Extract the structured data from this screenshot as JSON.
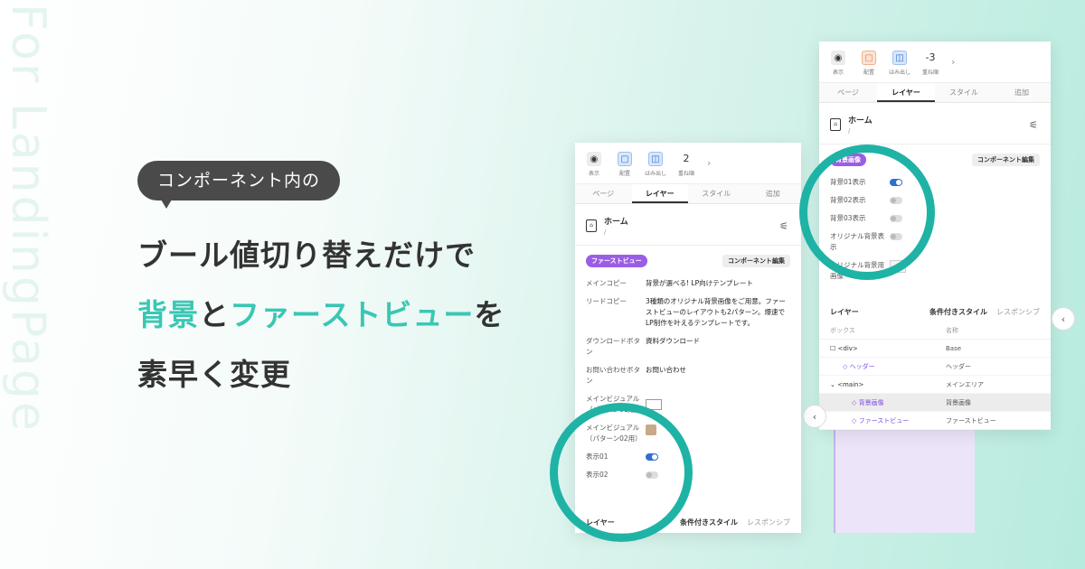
{
  "background_text": "For LandingPage",
  "bubble": "コンポーネント内の",
  "headline": {
    "line1": "ブール値切り替えだけで",
    "line2_a": "背景",
    "line2_b": "と",
    "line2_c": "ファーストビュー",
    "line2_d": "を",
    "line3": "素早く変更"
  },
  "colors": {
    "accent_teal": "#3ac7b4",
    "ring": "#1fb3a6",
    "tag_purple": "#9b5de5",
    "toggle_on": "#2f6fcf"
  },
  "panel_front": {
    "toolbar": [
      {
        "icon": "eye-icon",
        "label": "表示"
      },
      {
        "icon": "align-icon",
        "label": "配置"
      },
      {
        "icon": "overflow-icon",
        "label": "はみ出し"
      },
      {
        "value": "2",
        "label": "重ね順"
      }
    ],
    "tabs": [
      "ページ",
      "レイヤー",
      "スタイル",
      "追加"
    ],
    "home": {
      "title": "ホーム",
      "path": "/"
    },
    "section_tag": "ファーストビュー",
    "edit_button": "コンポーネント編集",
    "props": [
      {
        "k": "メインコピー",
        "v": "背景が選べる! LP向けテンプレート"
      },
      {
        "k": "リードコピー",
        "v": "3種類のオリジナル背景画像をご用意。ファーストビューのレイアウトも2パターン。爆速でLP制作を叶えるテンプレートです。"
      },
      {
        "k": "ダウンロードボタン",
        "v": "資料ダウンロード"
      },
      {
        "k": "お問い合わせボタン",
        "v": "お問い合わせ"
      },
      {
        "k": "メインビジュアル（パターン01用）",
        "v": ""
      },
      {
        "k": "メインビジュアル（パターン02用）",
        "v": ""
      },
      {
        "k": "表示01",
        "toggle": true
      },
      {
        "k": "表示02",
        "toggle": false
      }
    ],
    "layer_title": "レイヤー",
    "conditional_style": "条件付きスタイル",
    "responsive": "レスポンシブ"
  },
  "panel_back": {
    "toolbar": [
      {
        "icon": "eye-icon",
        "label": "表示"
      },
      {
        "icon": "align-icon",
        "label": "配置"
      },
      {
        "icon": "overflow-icon",
        "label": "はみ出し"
      },
      {
        "value": "-3",
        "label": "重ね順"
      }
    ],
    "tabs": [
      "ページ",
      "レイヤー",
      "スタイル",
      "追加"
    ],
    "home": {
      "title": "ホーム",
      "path": "/"
    },
    "section_tag": "背景画像",
    "edit_button": "コンポーネント編集",
    "props": [
      {
        "k": "背景01表示",
        "toggle": true
      },
      {
        "k": "背景02表示",
        "toggle": false
      },
      {
        "k": "背景03表示",
        "toggle": false
      },
      {
        "k": "オリジナル背景表示",
        "toggle": false
      },
      {
        "k": "オリジナル背景用画像",
        "v": ""
      }
    ],
    "layer_title": "レイヤー",
    "conditional_style": "条件付きスタイル",
    "responsive": "レスポンシブ",
    "tree_cols": [
      "ボックス",
      "名称"
    ],
    "tree": [
      {
        "n": "<div>",
        "name": "Base"
      },
      {
        "n": "ヘッダー",
        "name": "ヘッダー"
      },
      {
        "n": "<main>",
        "name": "メインエリア"
      },
      {
        "n": "背景画像",
        "name": "背景画像"
      },
      {
        "n": "ファーストビュー",
        "name": "ファーストビュー"
      }
    ]
  }
}
